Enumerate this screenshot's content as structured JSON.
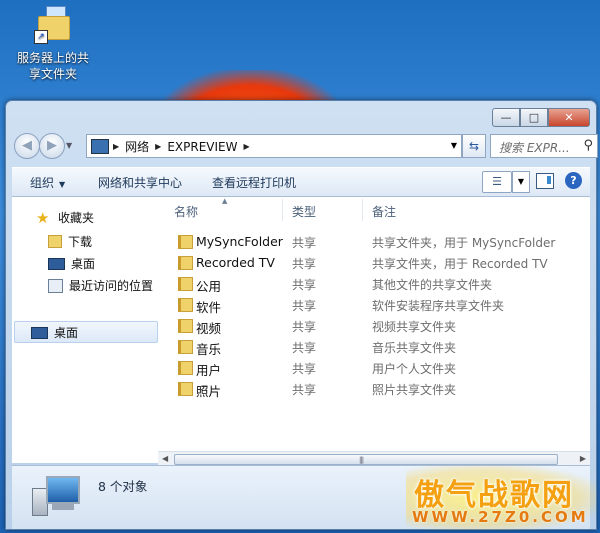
{
  "desktop": {
    "shortcut_label_line1": "服务器上的共",
    "shortcut_label_line2": "享文件夹"
  },
  "window": {
    "caption": {
      "min": "—",
      "max": "□",
      "close": "✕"
    },
    "address": {
      "crumbs": [
        "网络",
        "EXPREVIEW"
      ]
    },
    "search_placeholder": "搜索 EXPR...",
    "toolbar": {
      "organize": "组织",
      "network_center": "网络和共享中心",
      "view_printers": "查看远程打印机"
    }
  },
  "nav_pane": {
    "favorites": "收藏夹",
    "items": [
      {
        "label": "下载",
        "icon": "download-folder-icon"
      },
      {
        "label": "桌面",
        "icon": "desktop-icon"
      },
      {
        "label": "最近访问的位置",
        "icon": "recent-places-icon"
      }
    ],
    "selected": "桌面"
  },
  "columns": {
    "name": "名称",
    "type": "类型",
    "note": "备注"
  },
  "rows": [
    {
      "name": "MySyncFolder",
      "type": "共享",
      "note": "共享文件夹，用于 MySyncFolder"
    },
    {
      "name": "Recorded TV",
      "type": "共享",
      "note": "共享文件夹，用于 Recorded TV"
    },
    {
      "name": "公用",
      "type": "共享",
      "note": "其他文件的共享文件夹"
    },
    {
      "name": "软件",
      "type": "共享",
      "note": "软件安装程序共享文件夹"
    },
    {
      "name": "视频",
      "type": "共享",
      "note": "视频共享文件夹"
    },
    {
      "name": "音乐",
      "type": "共享",
      "note": "音乐共享文件夹"
    },
    {
      "name": "用户",
      "type": "共享",
      "note": "用户个人文件夹"
    },
    {
      "name": "照片",
      "type": "共享",
      "note": "照片共享文件夹"
    }
  ],
  "details": {
    "count": "8 个对象"
  },
  "watermark": {
    "title": "傲气战歌网",
    "url": "WWW.27Z0.COM"
  }
}
